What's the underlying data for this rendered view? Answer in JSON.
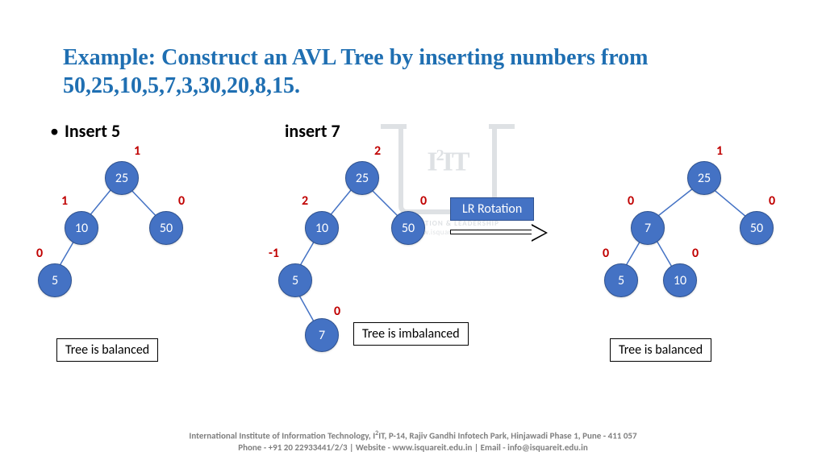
{
  "title": "Example: Construct an AVL Tree by inserting numbers from 50,25,10,5,7,3,30,20,8,15.",
  "subheads": {
    "insert5": "Insert 5",
    "insert7": "insert 7"
  },
  "rotation_label": "LR Rotation",
  "captions": {
    "balanced": "Tree is balanced",
    "imbalanced": "Tree is imbalanced"
  },
  "tree1": {
    "n25": "25",
    "n10": "10",
    "n50": "50",
    "n5": "5",
    "bf25": "1",
    "bf10": "1",
    "bf50": "0",
    "bf5": "0"
  },
  "tree2": {
    "n25": "25",
    "n10": "10",
    "n50": "50",
    "n5": "5",
    "n7": "7",
    "bf25": "2",
    "bf10": "2",
    "bf50": "0",
    "bf5": "-1",
    "bf7": "0"
  },
  "tree3": {
    "n25": "25",
    "n7": "7",
    "n50": "50",
    "n5": "5",
    "n10": "10",
    "bf25": "1",
    "bf7": "0",
    "bf50": "0",
    "bf5": "0",
    "bf10": "0"
  },
  "watermark": {
    "brand": "I²IT",
    "line1": "INNOVATION & LEADERSHIP",
    "line2": "www.isquareit.edu.in"
  },
  "footer": {
    "line1": "International Institute of Information Technology, I²IT, P-14, Rajiv Gandhi Infotech Park, Hinjawadi Phase 1, Pune - 411 057",
    "line2": "Phone - +91 20 22933441/2/3 | Website - www.isquareit.edu.in | Email - info@isquareit.edu.in"
  }
}
